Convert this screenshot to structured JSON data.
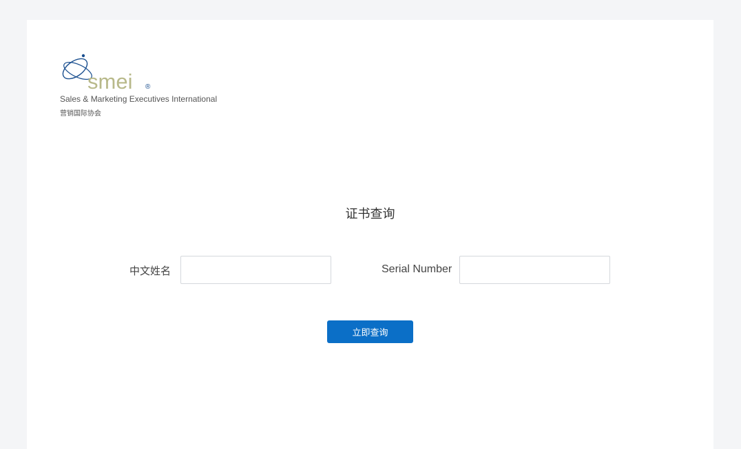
{
  "logo": {
    "wordmark": "smei",
    "registered_mark": "®",
    "subtitle_en": "Sales & Marketing Executives International",
    "subtitle_cn": "营销国际协会",
    "colors": {
      "wordmark": "#b8b98a",
      "swoosh": "#1a4f8f"
    }
  },
  "form": {
    "title": "证书查询",
    "name_label": "中文姓名",
    "name_value": "",
    "serial_label": "Serial Number",
    "serial_value": "",
    "submit_label": "立即查询"
  },
  "colors": {
    "background": "#f4f5f7",
    "card": "#ffffff",
    "button": "#0b6fc7"
  }
}
